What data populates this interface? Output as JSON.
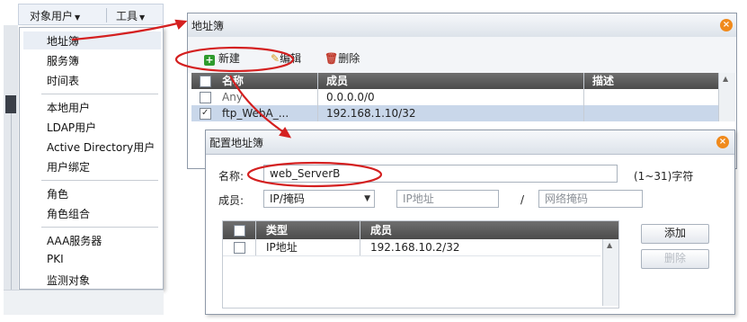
{
  "topbar": {
    "object_users": "对象用户",
    "tools": "工具"
  },
  "menu": {
    "items": [
      "地址簿",
      "服务簿",
      "时间表",
      "本地用户",
      "LDAP用户",
      "Active Directory用户",
      "用户绑定",
      "角色",
      "角色组合",
      "AAA服务器",
      "PKI",
      "监测对象"
    ]
  },
  "address_book": {
    "title": "地址簿",
    "toolbar": {
      "new": "新建",
      "edit": "编辑",
      "delete": "删除"
    },
    "columns": [
      "名称",
      "成员",
      "描述"
    ],
    "rows": [
      {
        "name": "Any",
        "member": "0.0.0.0/0",
        "desc": "",
        "checked": false
      },
      {
        "name": "ftp_WebA_...",
        "member": "192.168.1.10/32",
        "desc": "",
        "checked": true
      }
    ]
  },
  "config": {
    "title": "配置地址簿",
    "name_label": "名称:",
    "name_value": "web_ServerB",
    "name_hint": "(1~31)字符",
    "member_label": "成员:",
    "member_type": "IP/掩码",
    "ip_placeholder": "IP地址",
    "slash": "/",
    "mask_placeholder": "网络掩码",
    "columns": [
      "类型",
      "成员"
    ],
    "rows": [
      {
        "type": "IP地址",
        "member": "192.168.10.2/32"
      }
    ],
    "add": "添加",
    "remove": "删除"
  },
  "colors": {
    "annotation": "#d42020",
    "close_button": "#f08a1c",
    "header_bg": "#555555"
  }
}
